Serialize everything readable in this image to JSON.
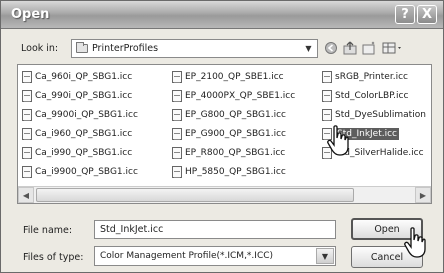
{
  "window": {
    "title": "Open",
    "help_label": "?",
    "close_label": "X"
  },
  "toolbar": {
    "look_in_label": "Look in:",
    "look_in_value": "PrinterProfiles",
    "back_icon": "back-arrow-icon",
    "up_icon": "up-folder-icon",
    "new_folder_icon": "new-folder-icon",
    "view_menu_icon": "view-menu-icon"
  },
  "files": [
    {
      "name": "Ca_960i_QP_SBG1.icc",
      "selected": false
    },
    {
      "name": "Ca_990i_QP_SBG1.icc",
      "selected": false
    },
    {
      "name": "Ca_9900i_QP_SBG1.icc",
      "selected": false
    },
    {
      "name": "Ca_i960_QP_SBG1.icc",
      "selected": false
    },
    {
      "name": "Ca_i990_QP_SBG1.icc",
      "selected": false
    },
    {
      "name": "Ca_i9900_QP_SBG1.icc",
      "selected": false
    },
    {
      "name": "EP_2100_QP_SBE1.icc",
      "selected": false
    },
    {
      "name": "EP_4000PX_QP_SBE1.icc",
      "selected": false
    },
    {
      "name": "EP_G800_QP_SBG1.icc",
      "selected": false
    },
    {
      "name": "EP_G900_QP_SBG1.icc",
      "selected": false
    },
    {
      "name": "EP_R800_QP_SBG1.icc",
      "selected": false
    },
    {
      "name": "HP_5850_QP_SBG1.icc",
      "selected": false
    },
    {
      "name": "sRGB_Printer.icc",
      "selected": false
    },
    {
      "name": "Std_ColorLBP.icc",
      "selected": false
    },
    {
      "name": "Std_DyeSublimation",
      "selected": false
    },
    {
      "name": "Std_InkJet.icc",
      "selected": true
    },
    {
      "name": "Std_SilverHalide.icc",
      "selected": false
    }
  ],
  "form": {
    "file_name_label": "File name:",
    "file_name_value": "Std_InkJet.icc",
    "file_type_label": "Files of type:",
    "file_type_value": "Color Management Profile(*.ICM,*.ICC)"
  },
  "buttons": {
    "open_label": "Open",
    "cancel_label": "Cancel"
  }
}
